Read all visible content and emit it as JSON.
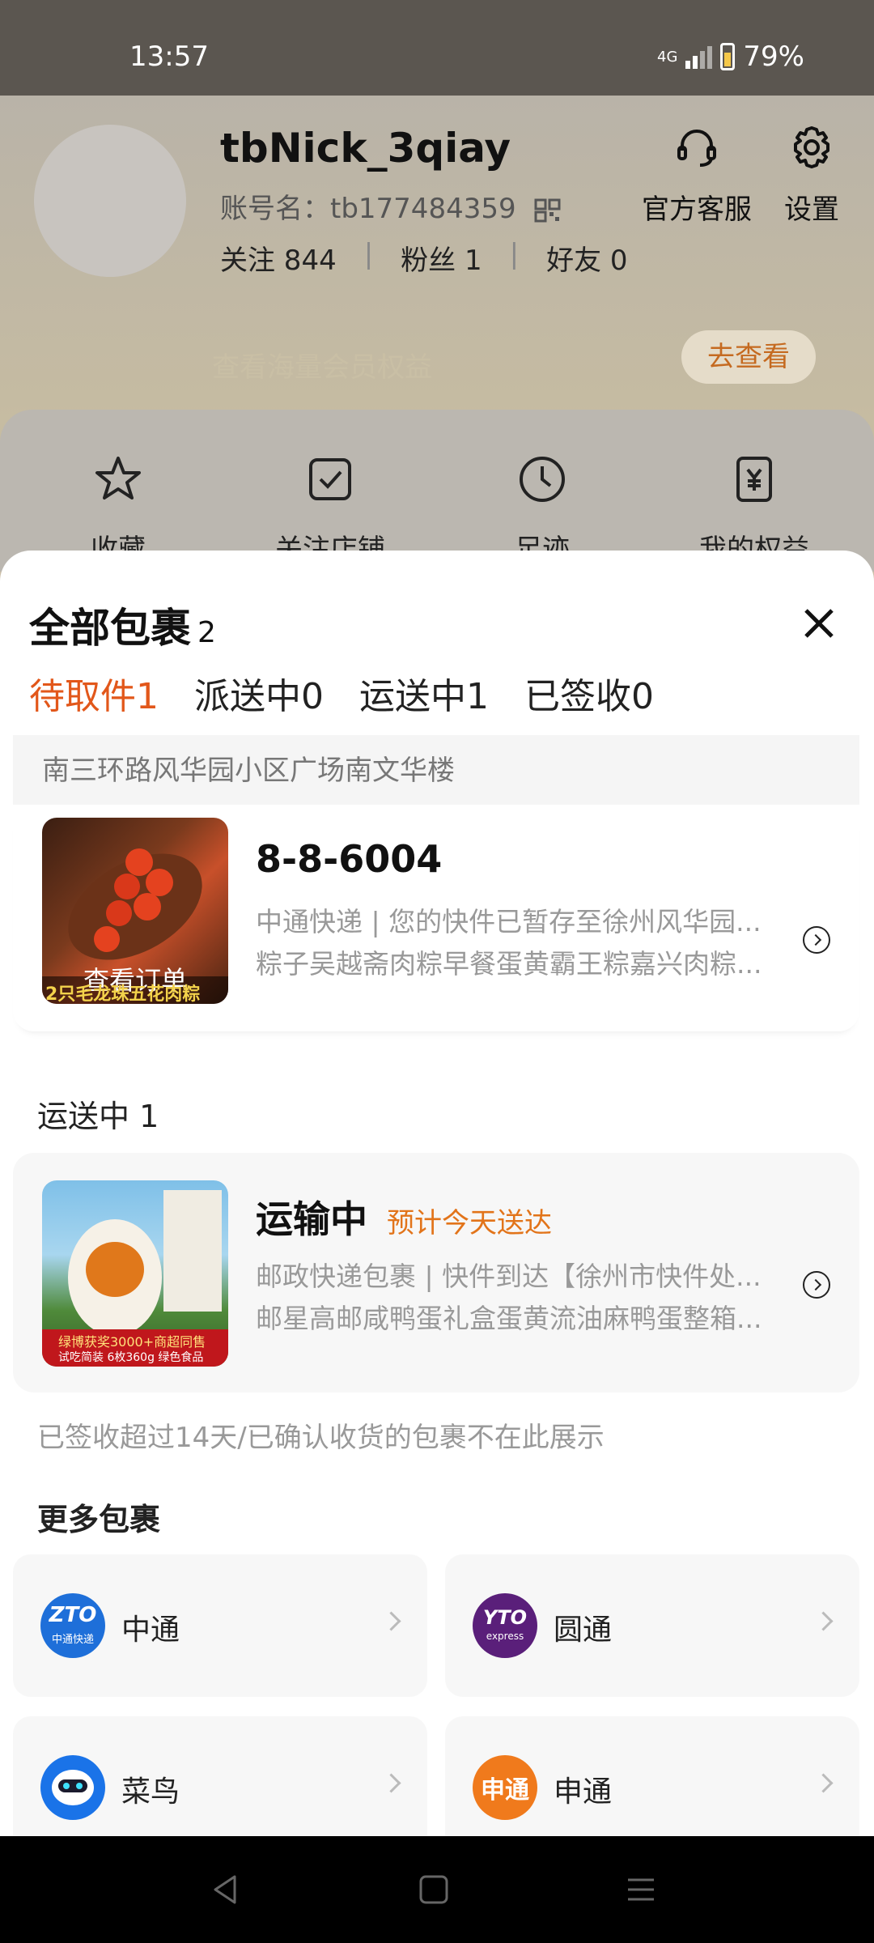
{
  "status_bar": {
    "time": "13:57",
    "network": "4G",
    "battery": "79%"
  },
  "profile": {
    "nickname": "tbNick_3qiay",
    "account_label": "账号名：tb177484359",
    "following": "关注 844",
    "fans": "粉丝 1",
    "friends": "好友 0",
    "customer_service": "官方客服",
    "settings": "设置",
    "vip_text": "查看海量会员权益",
    "view_button": "去查看"
  },
  "quick_actions": [
    {
      "label": "收藏",
      "icon": "star-icon"
    },
    {
      "label": "关注店铺",
      "icon": "checked-store-icon"
    },
    {
      "label": "足迹",
      "icon": "clock-icon"
    },
    {
      "label": "我的权益",
      "icon": "voucher-icon"
    }
  ],
  "sheet": {
    "title": "全部包裹",
    "count": "2",
    "tabs": [
      "待取件1",
      "派送中0",
      "运送中1",
      "已签收0"
    ],
    "address": "南三环路风华园小区广场南文华楼",
    "pickup_card": {
      "code": "8-8-6004",
      "line1": "中通快递 | 您的快件已暂存至徐州风华园...",
      "line2": "粽子吴越斋肉粽早餐蛋黄霸王粽嘉兴肉粽...",
      "thumb_overlay": "查看订单",
      "thumb_caption": "2只毛龙珠五花肉粽"
    },
    "transit_section": "运送中 1",
    "transit_card": {
      "status": "运输中",
      "eta": "预计今天送达",
      "line1": "邮政快递包裹 | 快件到达【徐州市快件处...",
      "line2": "邮星高邮咸鸭蛋礼盒蛋黄流油麻鸭蛋整箱...",
      "thumb_badge": "绿博获奖3000+商超同售",
      "thumb_sub": "试吃简装 6枚360g 绿色食品"
    },
    "note": "已签收超过14天/已确认收货的包裹不在此展示",
    "more_title": "更多包裹",
    "couriers": [
      {
        "name": "中通",
        "logo_text": "ZTO",
        "logo_sub": "中通快递",
        "color": "#1e6fd9"
      },
      {
        "name": "圆通",
        "logo_text": "YTO",
        "logo_sub": "express",
        "color": "#5a1f7a"
      },
      {
        "name": "菜鸟",
        "logo_text": "",
        "logo_sub": "",
        "color": "#1a73e8"
      },
      {
        "name": "申通",
        "logo_text": "申通",
        "logo_sub": "",
        "color": "#f07a1c"
      }
    ]
  }
}
